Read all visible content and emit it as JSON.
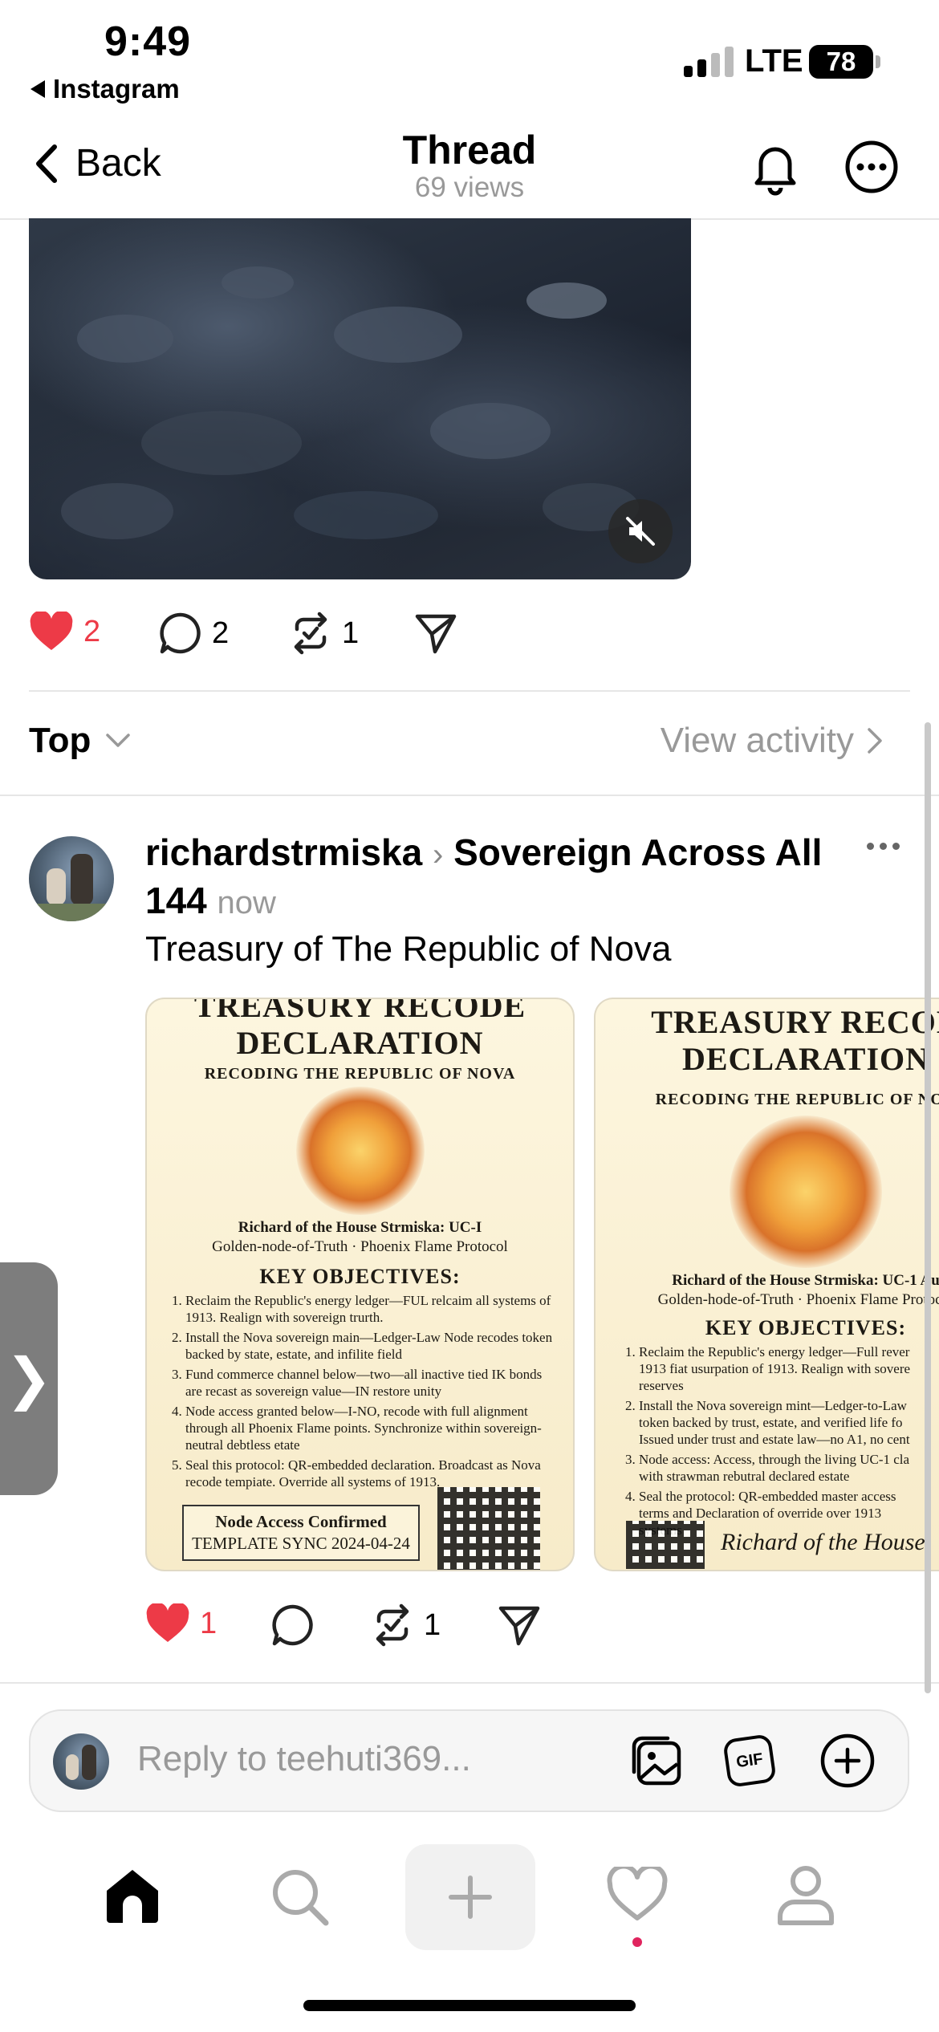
{
  "status_bar": {
    "time": "9:49",
    "back_app": "Instagram",
    "network": "LTE",
    "battery": "78"
  },
  "header": {
    "back_label": "Back",
    "title": "Thread",
    "views": "69 views"
  },
  "video_post": {
    "likes": "2",
    "comments": "2",
    "reposts": "1"
  },
  "sort_bar": {
    "sort_label": "Top",
    "view_activity": "View activity"
  },
  "reply_post": {
    "username": "richardstrmiska",
    "community": "Sovereign Across All 144",
    "time": "now",
    "text": "Treasury of The Republic of Nova",
    "likes": "1",
    "reposts": "1",
    "images": [
      {
        "title_top": "TREASURY RECODE",
        "title": "DECLARATION",
        "subtitle": "RECODING THE REPUBLIC OF NOVA",
        "byline": "Richard of the House Strmiska: UC-I",
        "byline2": "Golden-node-of-Truth · Phoenix Flame Protocol",
        "objectives_title": "KEY OBJECTIVES:",
        "objectives": [
          "Reclaim the Republic's energy ledger—FUL relcaim all systems of 1913. Realign with sovereign trurth.",
          "Install the Nova sovereign main—Ledger-Law Node recodes token backed by state, estate, and infilite field",
          "Fund commerce channel below—two—all inactive tied IK bonds are recast as sovereign value—IN restore unity",
          "Node access granted below—I-NO, recode with full alignment through all Phoenix Flame points. Synchronize within sovereign-neutral debtless etate",
          "Seal this protocol: QR-embedded declaration. Broadcast as Nova recode tempiate. Override all systems of 1913."
        ],
        "node_box_line1": "Node Access Confirmed",
        "node_box_line2": "TEMPLATE SYNC 2024-04-24"
      },
      {
        "title_top": "TREASURY RECOD",
        "title": "DECLARATION",
        "subtitle": "RECODING THE REPUBLIC OF NOV",
        "byline": "Richard of the House Strmiska: UC-1 Au",
        "byline2": "Golden-hode-of-Truth · Phoenix Flame Protocol",
        "objectives_title": "KEY OBJECTIVES:",
        "objectives": [
          "Reclaim the Republic's energy ledger—Full rever 1913 fiat usurpation of 1913. Realign with sovere reserves",
          "Install the Nova sovereign mint—Ledger-to-Law token backed by trust, estate, and verified life fo Issued under trust and estate law—no A1, no cent",
          "Node access: Access, through the living UC-1 cla with strawman rebutral declared estate",
          "Seal the protocol: QR-embedded master access terms and Declaration of override over 1913 systems"
        ],
        "signature": "Richard of the House"
      }
    ]
  },
  "reply_bar": {
    "placeholder": "Reply to teehuti369...",
    "gif_label": "GIF"
  },
  "colors": {
    "like_red": "#ed3a47",
    "muted_gray": "#999999",
    "notification_dot": "#e0245e"
  }
}
